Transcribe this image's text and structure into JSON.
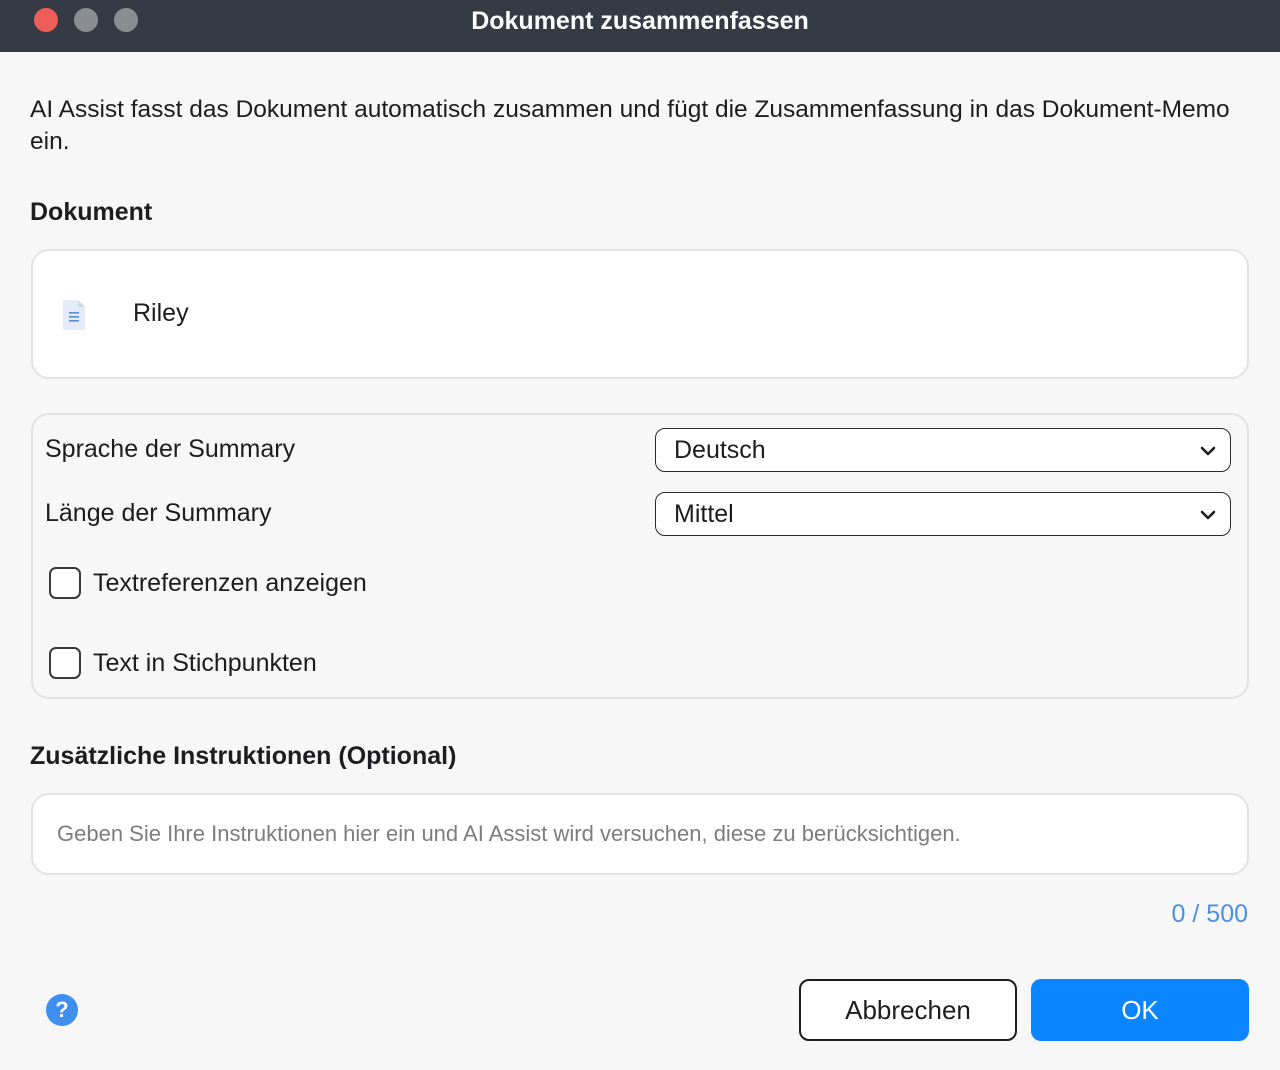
{
  "window": {
    "title": "Dokument zusammenfassen"
  },
  "description": "AI Assist fasst das Dokument automatisch zusammen und fügt die Zusammenfassung in das Dokument-Memo ein.",
  "document_section": {
    "label": "Dokument",
    "document_name": "Riley",
    "icon": "document-icon"
  },
  "options": {
    "language_label": "Sprache der Summary",
    "language_value": "Deutsch",
    "length_label": "Länge der Summary",
    "length_value": "Mittel",
    "show_text_refs_label": "Textreferenzen anzeigen",
    "show_text_refs_checked": false,
    "bullet_points_label": "Text in Stichpunkten",
    "bullet_points_checked": false
  },
  "instructions": {
    "label": "Zusätzliche Instruktionen (Optional)",
    "value": "",
    "placeholder": "Geben Sie Ihre Instruktionen hier ein und AI Assist wird versuchen, diese zu berücksichtigen.",
    "counter": "0 / 500"
  },
  "footer": {
    "help_label": "?",
    "cancel_label": "Abbrechen",
    "ok_label": "OK"
  },
  "colors": {
    "accent": "#0a84ff",
    "titlebar": "#363a44",
    "counter": "#4a90e2"
  }
}
